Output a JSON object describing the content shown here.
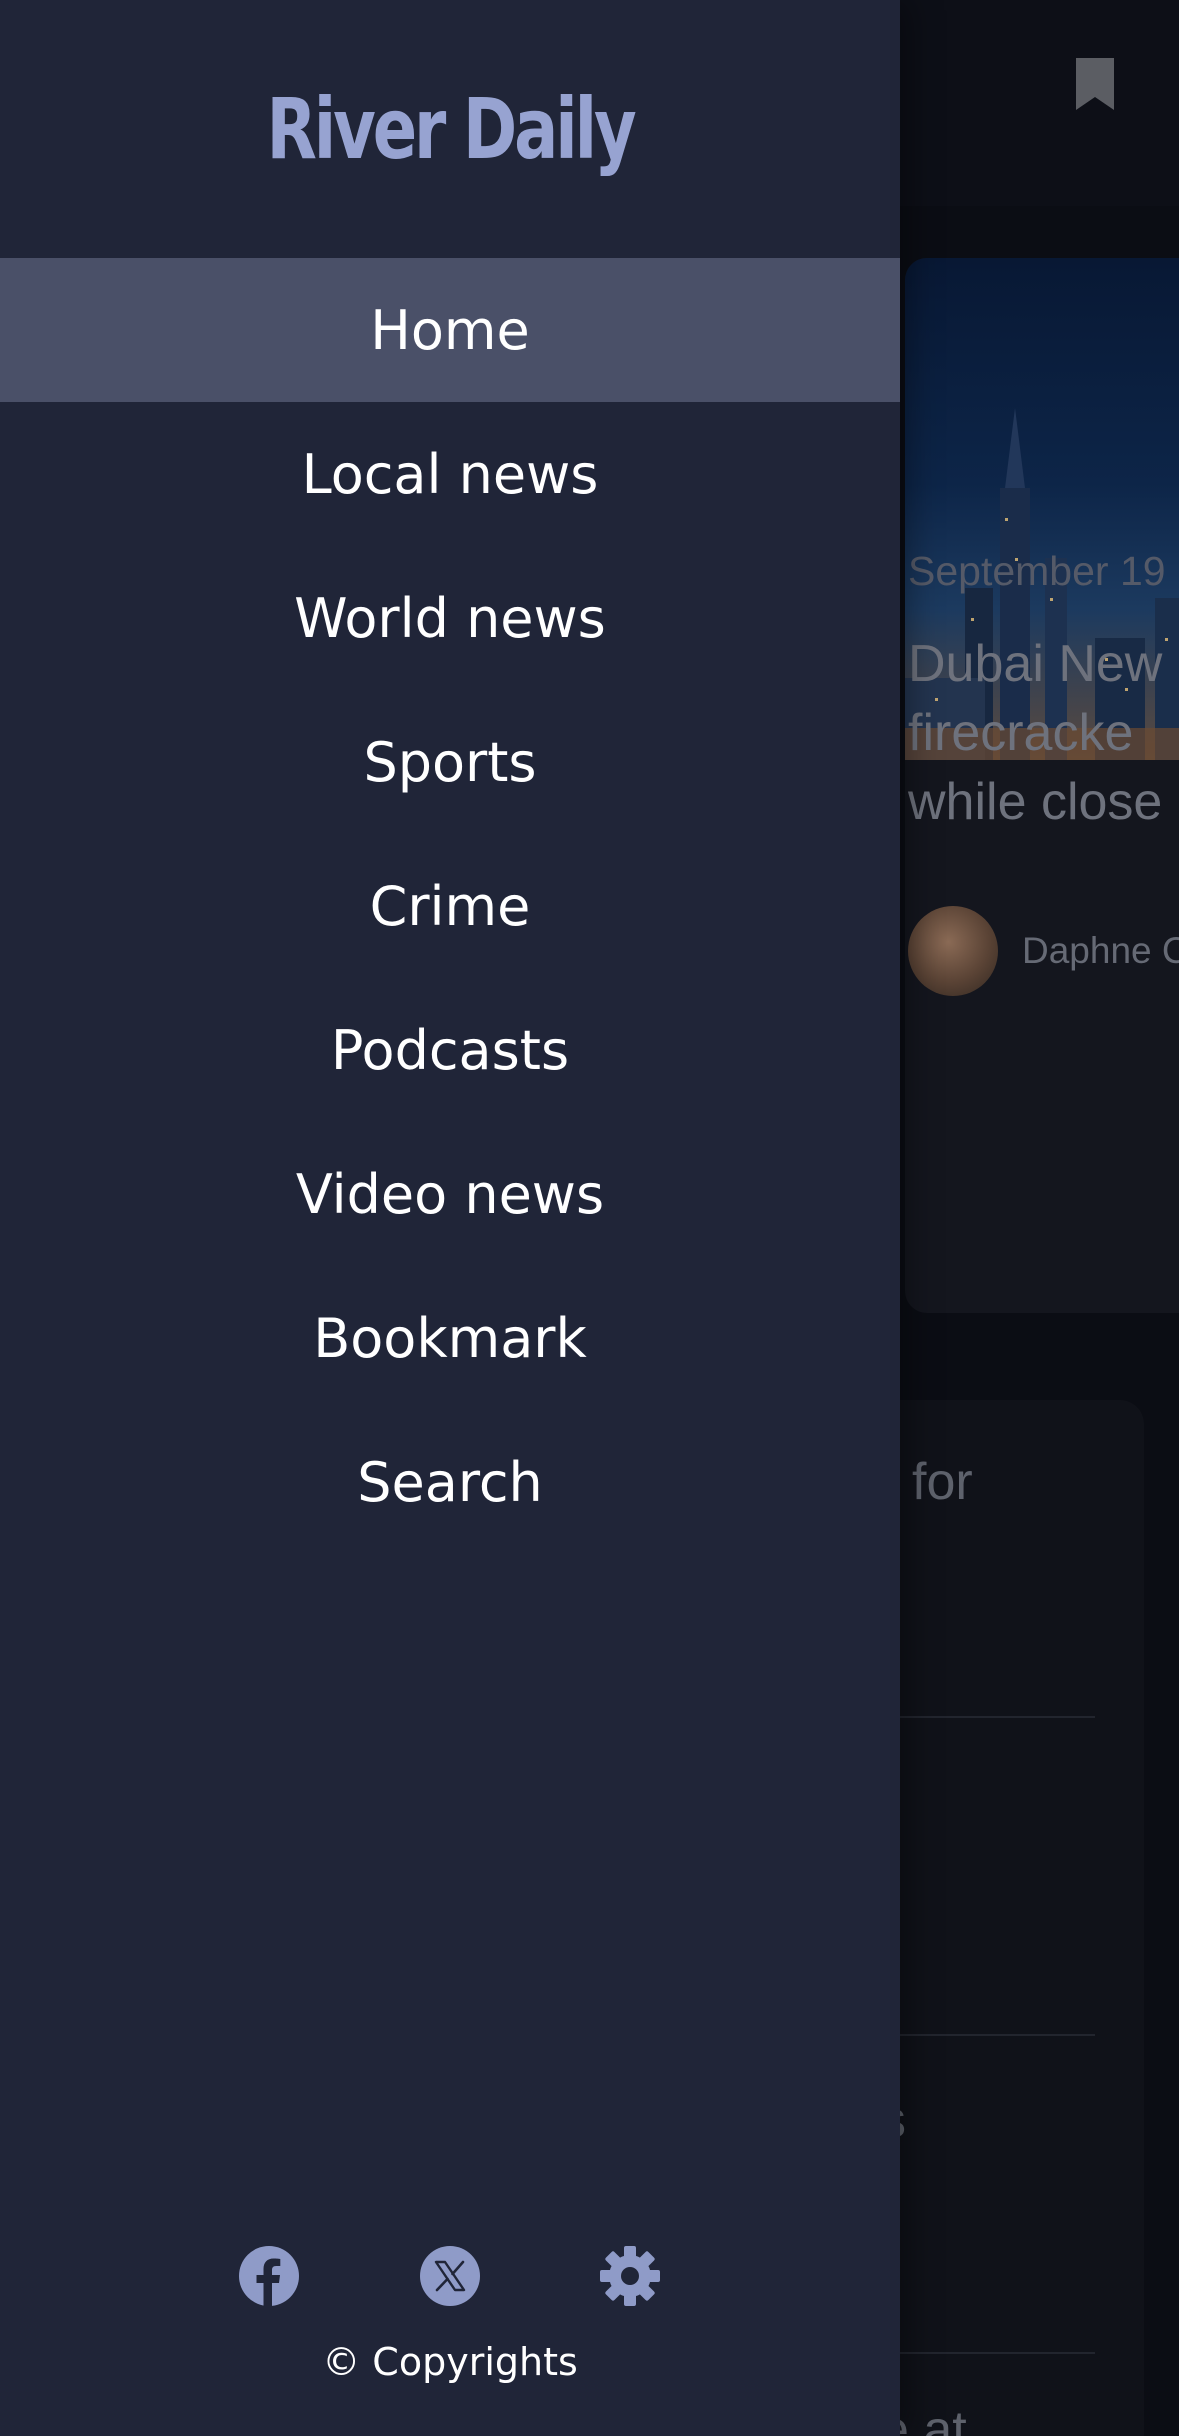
{
  "app": {
    "name": "River Daily"
  },
  "drawer": {
    "nav_items": [
      {
        "label": "Home",
        "active": true
      },
      {
        "label": "Local news",
        "active": false
      },
      {
        "label": "World news",
        "active": false
      },
      {
        "label": "Sports",
        "active": false
      },
      {
        "label": "Crime",
        "active": false
      },
      {
        "label": "Podcasts",
        "active": false
      },
      {
        "label": "Video news",
        "active": false
      },
      {
        "label": "Bookmark",
        "active": false
      },
      {
        "label": "Search",
        "active": false
      }
    ],
    "social_icons": [
      "facebook-icon",
      "x-icon",
      "gear-icon"
    ],
    "copyright": "© Copyrights"
  },
  "background": {
    "featured_article": {
      "date": "September 19",
      "title_lines": [
        "Dubai New",
        "firecracke",
        "while close"
      ],
      "author": "Daphne C"
    },
    "list_fragments": [
      "for",
      "s",
      "e at"
    ]
  },
  "colors": {
    "drawer_bg": "#202538",
    "active_item_bg": "#4a5068",
    "logo": "#97a3d1",
    "icon": "#8f9bc8",
    "text": "#ffffff"
  }
}
